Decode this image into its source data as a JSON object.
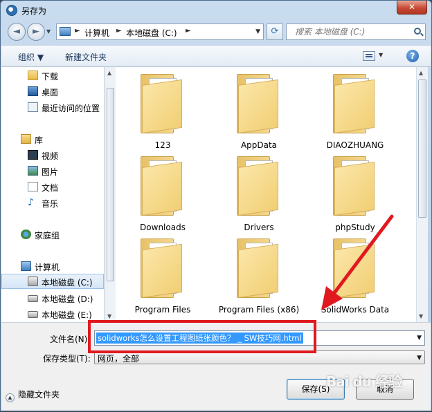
{
  "window": {
    "title": "另存为",
    "close_label": "✕"
  },
  "nav": {
    "back_glyph": "◄",
    "forward_glyph": "►",
    "breadcrumbs": [
      "计算机",
      "本地磁盘 (C:)"
    ],
    "search_placeholder": "搜索 本地磁盘 (C:)"
  },
  "toolbar": {
    "organize": "组织 ▼",
    "new_folder": "新建文件夹",
    "help": "?"
  },
  "sidebar": {
    "items": [
      {
        "label": "下载",
        "icon": "downloads-folder-icon"
      },
      {
        "label": "桌面",
        "icon": "desktop-icon"
      },
      {
        "label": "最近访问的位置",
        "icon": "recent-places-icon"
      },
      {
        "label": "库",
        "icon": "libraries-icon"
      },
      {
        "label": "视频",
        "icon": "videos-icon"
      },
      {
        "label": "图片",
        "icon": "pictures-icon"
      },
      {
        "label": "文档",
        "icon": "documents-icon"
      },
      {
        "label": "音乐",
        "icon": "music-icon"
      },
      {
        "label": "家庭组",
        "icon": "homegroup-icon"
      },
      {
        "label": "计算机",
        "icon": "computer-icon"
      },
      {
        "label": "本地磁盘 (C:)",
        "icon": "drive-icon"
      },
      {
        "label": "本地磁盘 (D:)",
        "icon": "drive-icon"
      },
      {
        "label": "本地磁盘 (E:)",
        "icon": "drive-icon"
      }
    ]
  },
  "files": {
    "items": [
      {
        "name": "123"
      },
      {
        "name": "AppData"
      },
      {
        "name": "DIAOZHUANG"
      },
      {
        "name": "Downloads"
      },
      {
        "name": "Drivers"
      },
      {
        "name": "phpStudy"
      },
      {
        "name": "Program Files"
      },
      {
        "name": "Program Files (x86)"
      },
      {
        "name": "SolidWorks Data"
      }
    ]
  },
  "form": {
    "filename_label": "文件名(N):",
    "filename_value": "solidworks怎么设置工程图纸张颜色？ _ SW技巧网.html",
    "filetype_label": "保存类型(T):",
    "filetype_value": "网页，全部"
  },
  "footer": {
    "hide_folders": "隐藏文件夹",
    "save": "保存(S)",
    "cancel": "取消"
  },
  "watermark": "Bai du 经验",
  "colors": {
    "annotation_red": "#e0191f",
    "selection_blue": "#3399ff"
  }
}
